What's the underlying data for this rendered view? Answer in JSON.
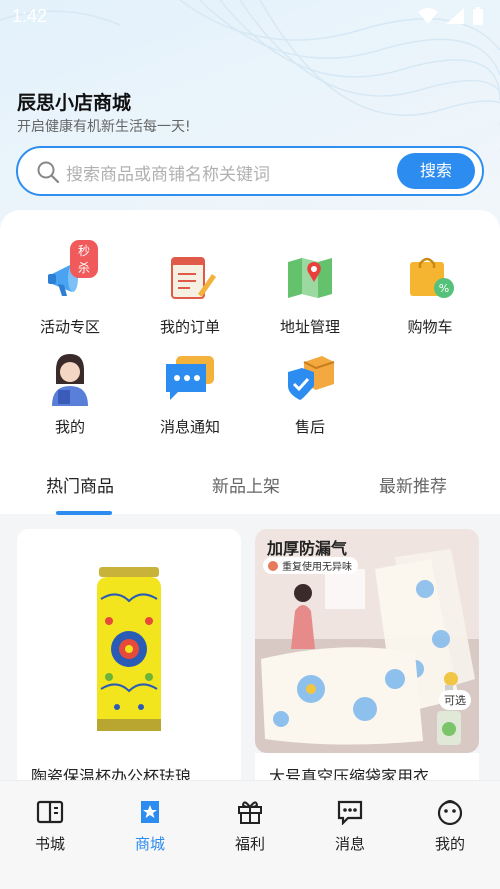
{
  "status_bar": {
    "time": "1:42"
  },
  "header": {
    "title": "辰思小店商城",
    "subtitle": "开启健康有机新生活每一天!"
  },
  "search": {
    "placeholder": "搜索商品或商铺名称关键词",
    "button_label": "搜索"
  },
  "quick_menu": [
    {
      "label": "活动专区",
      "icon": "megaphone-icon",
      "badge": "秒杀"
    },
    {
      "label": "我的订单",
      "icon": "order-list-icon"
    },
    {
      "label": "地址管理",
      "icon": "map-icon"
    },
    {
      "label": "购物车",
      "icon": "shopping-bag-icon"
    },
    {
      "label": "我的",
      "icon": "avatar-icon"
    },
    {
      "label": "消息通知",
      "icon": "chat-bubble-icon"
    },
    {
      "label": "售后",
      "icon": "shield-box-icon"
    }
  ],
  "tabs": [
    {
      "label": "热门商品",
      "active": true
    },
    {
      "label": "新品上架",
      "active": false
    },
    {
      "label": "最新推荐",
      "active": false
    }
  ],
  "products": [
    {
      "name": "陶瓷保温杯办公杯珐琅"
    },
    {
      "name": "大号真空压缩袋家用衣",
      "overlay_title": "加厚防漏气",
      "overlay_sub": "重复使用无异味",
      "tag": "可选"
    }
  ],
  "bottom_nav": [
    {
      "label": "书城",
      "icon": "book-icon",
      "active": false
    },
    {
      "label": "商城",
      "icon": "store-icon",
      "active": true
    },
    {
      "label": "福利",
      "icon": "gift-icon",
      "active": false
    },
    {
      "label": "消息",
      "icon": "message-icon",
      "active": false
    },
    {
      "label": "我的",
      "icon": "face-icon",
      "active": false
    }
  ],
  "colors": {
    "accent": "#2d8cf0",
    "badge": "#f05a5a"
  }
}
